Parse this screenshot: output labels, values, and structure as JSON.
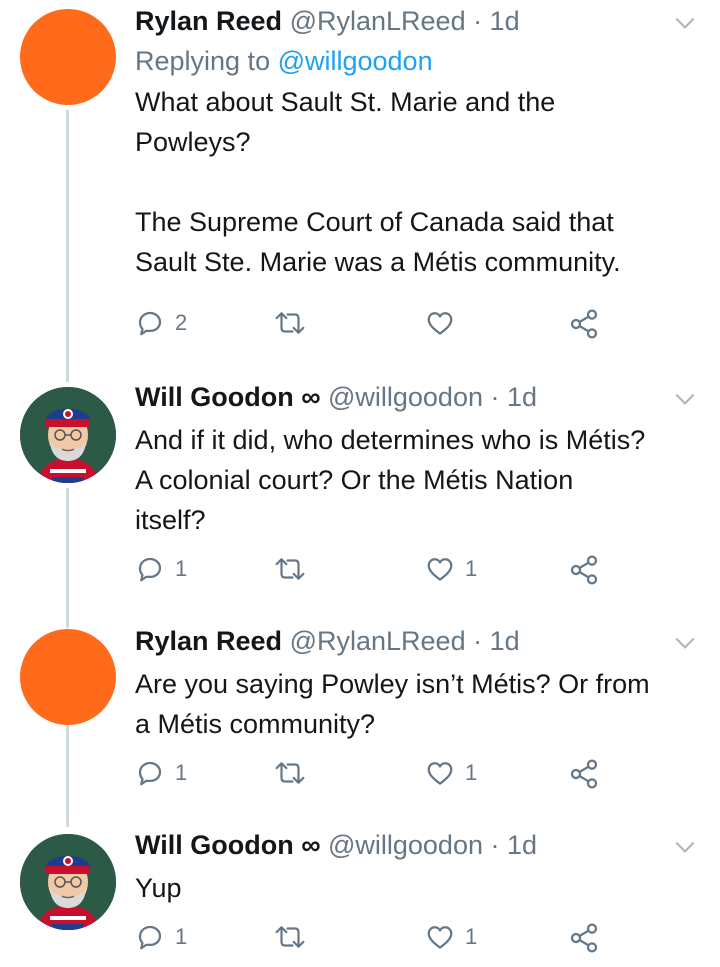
{
  "tweets": [
    {
      "name": "Rylan Reed",
      "handle": "@RylanLReed",
      "sep": "·",
      "time": "1d",
      "replying_prefix": "Replying to ",
      "replying_mention": "@willgoodon",
      "text": "What about Sault St. Marie and the\nPowleys?\n\nThe Supreme Court of Canada said that\nSault Ste. Marie was a Métis community.",
      "reply_count": "2",
      "retweet_count": "",
      "like_count": ""
    },
    {
      "name": "Will Goodon ∞",
      "handle": "@willgoodon",
      "sep": "·",
      "time": "1d",
      "text": "And if it did, who determines who is Métis?\nA colonial court? Or the Métis Nation\nitself?",
      "reply_count": "1",
      "retweet_count": "",
      "like_count": "1"
    },
    {
      "name": "Rylan Reed",
      "handle": "@RylanLReed",
      "sep": "·",
      "time": "1d",
      "text": "Are you saying Powley isn’t Métis? Or from\na Métis community?",
      "reply_count": "1",
      "retweet_count": "",
      "like_count": "1"
    },
    {
      "name": "Will Goodon ∞",
      "handle": "@willgoodon",
      "sep": "·",
      "time": "1d",
      "text": "Yup",
      "reply_count": "1",
      "retweet_count": "",
      "like_count": "1"
    }
  ],
  "colors": {
    "accent": "#1da1f2",
    "muted": "#657786",
    "thread_line": "#cfd9de",
    "avatar_orange": "#ff6b1a"
  },
  "icons": [
    "reply-icon",
    "retweet-icon",
    "like-icon",
    "share-icon",
    "chevron-down-icon"
  ]
}
